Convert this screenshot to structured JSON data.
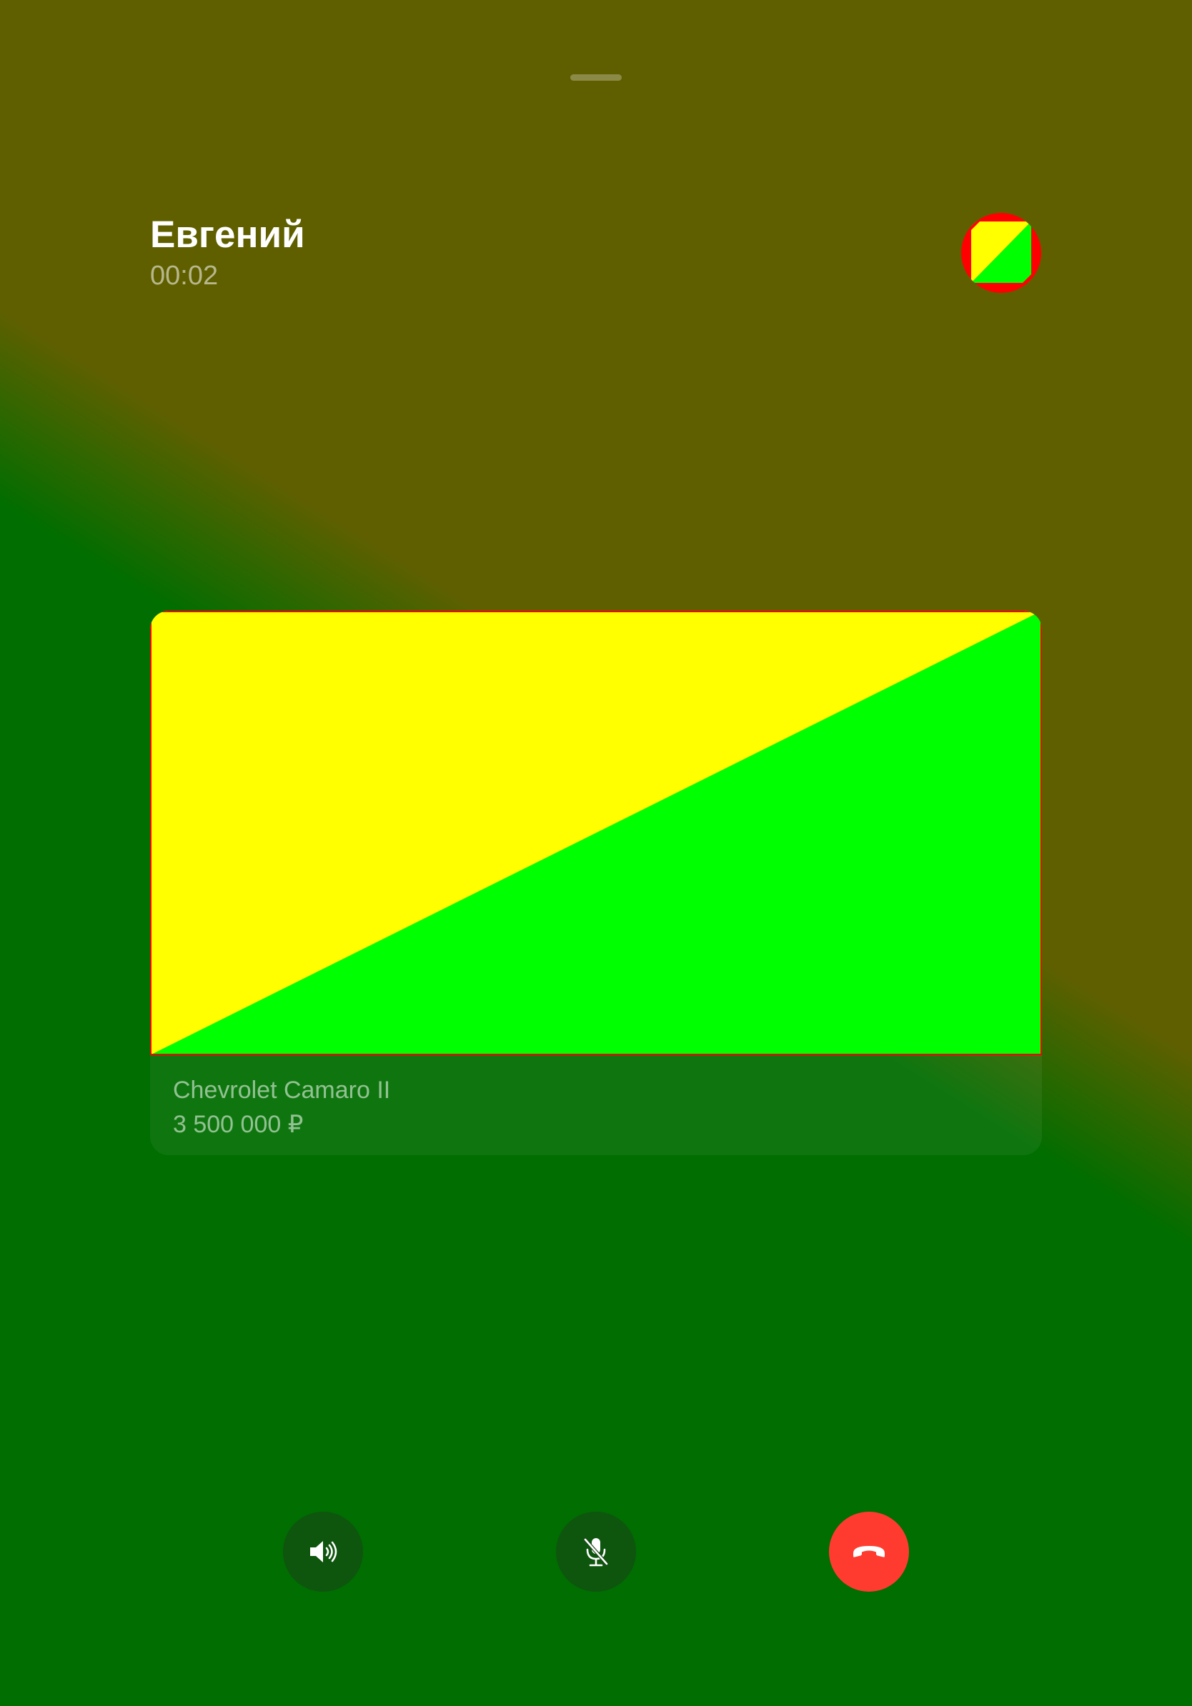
{
  "call": {
    "caller_name": "Евгений",
    "duration": "00:02"
  },
  "listing": {
    "title": "Chevrolet Camaro II",
    "price": "3 500 000 ₽"
  },
  "controls": {
    "speaker_icon": "speaker-icon",
    "mute_icon": "microphone-off-icon",
    "end_call_icon": "phone-hangup-icon"
  },
  "colors": {
    "background_top": "#5f5f00",
    "background_bottom": "#006e00",
    "end_call": "#ff3b30",
    "placeholder_yellow": "#ffff00",
    "placeholder_green": "#00ff00",
    "placeholder_border": "#ff0000"
  }
}
